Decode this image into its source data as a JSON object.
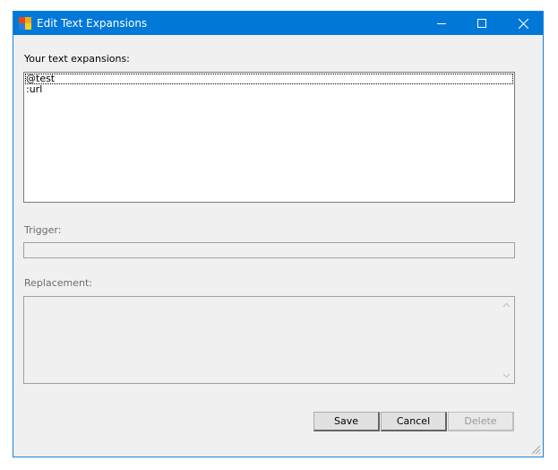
{
  "window": {
    "title": "Edit Text Expansions",
    "icon": "app-icon",
    "controls": {
      "minimize_icon": "minimize-icon",
      "maximize_icon": "maximize-icon",
      "close_icon": "close-icon"
    },
    "accent_color": "#0078d7"
  },
  "expansions": {
    "label": "Your text expansions:",
    "items": [
      {
        "text": "@test"
      },
      {
        "text": ":url"
      }
    ]
  },
  "trigger": {
    "label": "Trigger:",
    "value": ""
  },
  "replacement": {
    "label": "Replacement:",
    "value": ""
  },
  "buttons": {
    "save": "Save",
    "cancel": "Cancel",
    "delete": "Delete"
  }
}
